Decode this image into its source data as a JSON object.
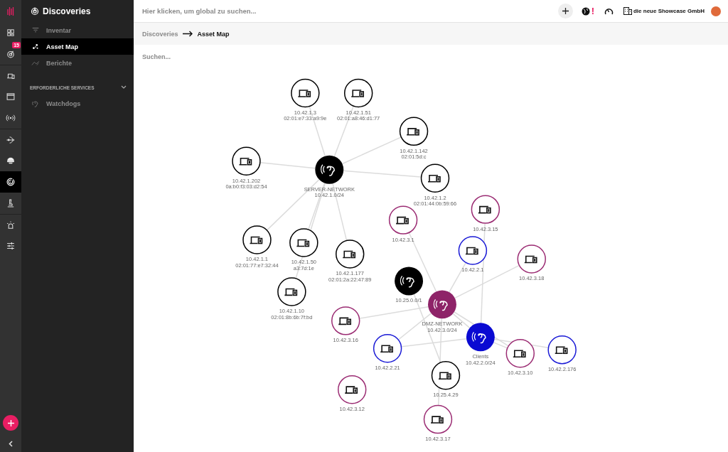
{
  "rail": {
    "badge": "15",
    "items": [
      {
        "kind": "dashboard",
        "selected": false
      },
      {
        "kind": "discovery",
        "selected": false
      },
      {
        "kind": "devices",
        "selected": false
      },
      {
        "kind": "window",
        "selected": false
      },
      {
        "kind": "broadcast",
        "selected": false
      },
      {
        "kind": "route",
        "selected": false
      },
      {
        "kind": "dome",
        "selected": false
      },
      {
        "kind": "radar",
        "selected": true
      },
      {
        "kind": "microscope",
        "selected": false
      },
      {
        "kind": "alarm",
        "selected": false
      },
      {
        "kind": "sliders",
        "selected": false
      }
    ]
  },
  "sidebar": {
    "title": "Discoveries",
    "items": [
      {
        "kind": "filter",
        "label": "Inventar",
        "selected": false
      },
      {
        "kind": "map",
        "label": "Asset Map",
        "selected": true
      },
      {
        "kind": "report",
        "label": "Berichte",
        "selected": false
      }
    ],
    "section": {
      "title": "ERFORDERLICHE SERVICES",
      "expanded": true,
      "items": [
        {
          "label": "Watchdogs"
        }
      ]
    }
  },
  "topbar": {
    "search": {
      "placeholder": "Hier klicken, um global zu suchen..."
    },
    "alert": "!",
    "organization": "die neue Showcase GmbH"
  },
  "breadcrumb": [
    "Discoveries",
    "Asset Map"
  ],
  "map": {
    "search": {
      "placeholder": "Suchen..."
    },
    "hubs": [
      {
        "lines": [
          "SERVER-NETWORK",
          "10.42.1.0/24"
        ],
        "color": "#000000"
      },
      {
        "lines": [
          "10.25.0.0/1"
        ],
        "color": "#000000"
      },
      {
        "lines": [
          "DMZ-NETWORK",
          "10.42.3.0/24"
        ],
        "color": "#8e2368"
      },
      {
        "lines": [
          "Clients",
          "10.42.2.0/24"
        ],
        "color": "#0a0ad2"
      }
    ],
    "devices": [
      {
        "lines": [
          "10.42.1.3",
          "02:01:e7:33:a9:9e"
        ],
        "color": "#000000"
      },
      {
        "lines": [
          "10.42.1.51",
          "02:01:a8:46:d1:77"
        ],
        "color": "#000000"
      },
      {
        "lines": [
          "10.42.1.142",
          "02:01:5d:c"
        ],
        "color": "#000000"
      },
      {
        "lines": [
          "10.42.1.202",
          "0a:b0:f3:03:d2:54"
        ],
        "color": "#000000"
      },
      {
        "lines": [
          "10.42.1.2",
          "02:01:44:0b:59:66"
        ],
        "color": "#000000"
      },
      {
        "lines": [
          "10.42.1.1",
          "02:01:77:e7:32:44"
        ],
        "color": "#000000"
      },
      {
        "lines": [
          "10.42.1.50",
          "a3:7d:1e"
        ],
        "color": "#000000"
      },
      {
        "lines": [
          "10.42.1.10",
          "02:01:8b:6b:7f:bd"
        ],
        "color": "#000000"
      },
      {
        "lines": [
          "10.42.1.177",
          "02:01:2a:22:47:89"
        ],
        "color": "#000000"
      },
      {
        "lines": [
          "10.42.3.1"
        ],
        "color": "#9b2c73"
      },
      {
        "lines": [
          "10.42.3.15"
        ],
        "color": "#9b2c73"
      },
      {
        "lines": [
          "10.42.2.1"
        ],
        "color": "#1a1ad6"
      },
      {
        "lines": [
          "10.42.3.18"
        ],
        "color": "#9b2c73"
      },
      {
        "lines": [
          "10.42.3.16"
        ],
        "color": "#9b2c73"
      },
      {
        "lines": [
          "10.42.2.21"
        ],
        "color": "#1a1ad6"
      },
      {
        "lines": [
          "10.42.3.12"
        ],
        "color": "#9b2c73"
      },
      {
        "lines": [
          "10.25.4.29"
        ],
        "color": "#000000"
      },
      {
        "lines": [
          "10.42.3.10"
        ],
        "color": "#9b2c73"
      },
      {
        "lines": [
          "10.42.2.176"
        ],
        "color": "#1a1ad6"
      },
      {
        "lines": [
          "10.42.3.17"
        ],
        "color": "#9b2c73"
      }
    ]
  }
}
